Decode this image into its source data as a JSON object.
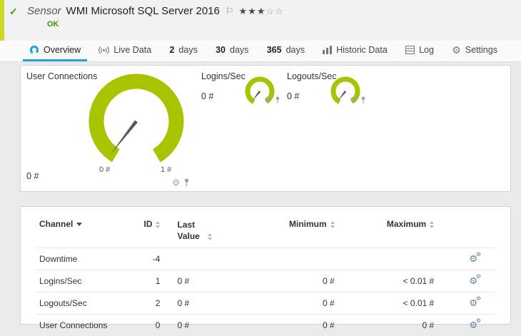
{
  "colors": {
    "accent": "#a8c400",
    "stripe": "#ccd929",
    "ok_green": "#3c9900",
    "tab_blue": "#26a5d8",
    "needle": "#585858",
    "page_bg": "#ebebeb",
    "panel_border": "#d4d4d4",
    "header_bg": "#f2f2f2",
    "gear_blue": "#667f99",
    "icon_gray": "#9aa0a6"
  },
  "icons": {
    "gear": "⚙",
    "flag": "⚐",
    "check": "✓"
  },
  "header": {
    "kind": "Sensor",
    "title": "WMI Microsoft SQL Server 2016",
    "stars_filled": "★★★",
    "stars_empty": "☆☆",
    "status": "OK"
  },
  "tabs": [
    {
      "label": "Overview"
    },
    {
      "label": "Live Data"
    },
    {
      "num": "2",
      "label": "days"
    },
    {
      "num": "30",
      "label": "days"
    },
    {
      "num": "365",
      "label": "days"
    },
    {
      "label": "Historic Data"
    },
    {
      "label": "Log"
    },
    {
      "label": "Settings"
    }
  ],
  "gauges": {
    "main": {
      "title": "User Connections",
      "value": "0 #",
      "scale_min": "0 #",
      "scale_max": "1 #"
    },
    "small": [
      {
        "title": "Logins/Sec",
        "value": "0 #"
      },
      {
        "title": "Logouts/Sec",
        "value": "0 #"
      }
    ]
  },
  "table": {
    "columns": [
      "Channel",
      "ID",
      "Last Value",
      "Minimum",
      "Maximum"
    ],
    "rows": [
      {
        "channel": "Downtime",
        "id": "-4",
        "last": "",
        "min": "",
        "max": ""
      },
      {
        "channel": "Logins/Sec",
        "id": "1",
        "last": "0 #",
        "min": "0 #",
        "max": "< 0.01 #"
      },
      {
        "channel": "Logouts/Sec",
        "id": "2",
        "last": "0 #",
        "min": "0 #",
        "max": "< 0.01 #"
      },
      {
        "channel": "User Connections",
        "id": "0",
        "last": "0 #",
        "min": "0 #",
        "max": "0 #"
      }
    ]
  }
}
